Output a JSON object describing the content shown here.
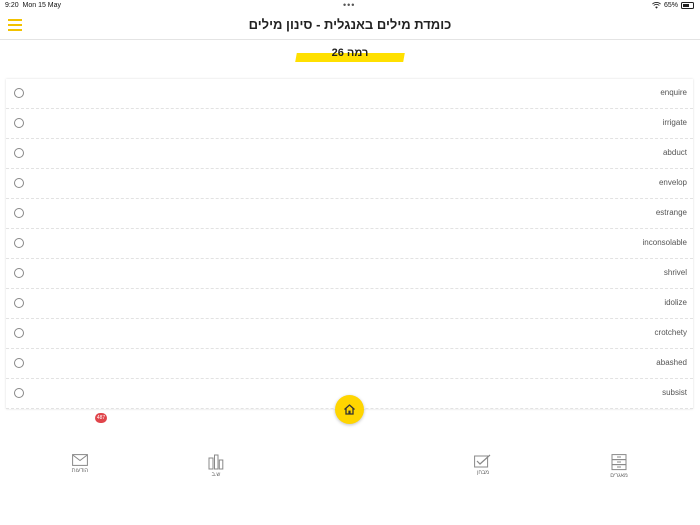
{
  "status_bar": {
    "time": "9:20",
    "date": "Mon 15 May",
    "battery": "65%"
  },
  "header": {
    "title": "כומדת מילים באנגלית - סינון מילים"
  },
  "level": {
    "label": "רמה 26"
  },
  "words": [
    "enquire",
    "irrigate",
    "abduct",
    "envelop",
    "estrange",
    "inconsolable",
    "shrivel",
    "idolize",
    "crotchety",
    "abashed",
    "subsist"
  ],
  "badge": {
    "count": "487"
  },
  "tabs": {
    "messages": {
      "label": "הודעות",
      "icon": "envelope-icon"
    },
    "tools": {
      "label": "ש.ב",
      "icon": "tools-icon"
    },
    "test": {
      "label": "מבחן",
      "icon": "checklist-icon"
    },
    "archive": {
      "label": "מאגרים",
      "icon": "archive-icon"
    }
  },
  "colors": {
    "accent": "#ffd500",
    "badge": "#e0454b"
  }
}
